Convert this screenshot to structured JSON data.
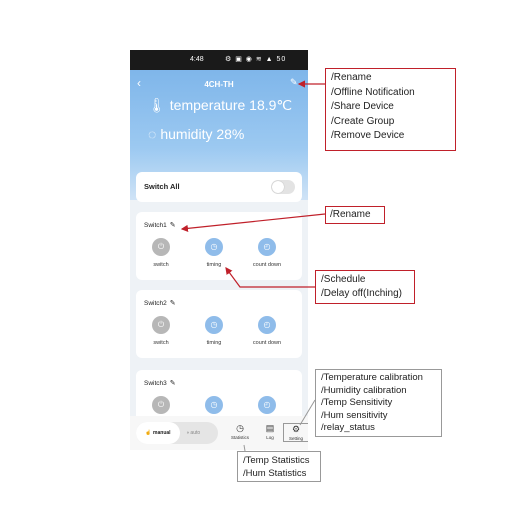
{
  "status_bar": {
    "time": "4:48",
    "icons": "⚙ ▣ ◉ ≋ ▲ 50"
  },
  "header": {
    "back_icon": "‹",
    "title": "4CH-TH",
    "edit_icon": "✎",
    "temperature_label": "temperature 18.9℃",
    "humidity_label": "humidity 28%"
  },
  "switch_all": {
    "label": "Switch All"
  },
  "switches": [
    {
      "name": "Switch1",
      "actions": [
        "switch",
        "timing",
        "count down"
      ]
    },
    {
      "name": "Switch2",
      "actions": [
        "switch",
        "timing",
        "count down"
      ]
    },
    {
      "name": "Switch3"
    }
  ],
  "bottom": {
    "manual_label": "manual",
    "auto_label": "auto",
    "tabs": [
      "Statistics",
      "Log",
      "Setting"
    ]
  },
  "annotations": {
    "device_menu": [
      "/Rename",
      "/Offline Notification",
      "/Share Device",
      "/Create Group",
      "/Remove Device"
    ],
    "switch_rename": "/Rename",
    "timing_menu": [
      "/Schedule",
      "/Delay off(Inching)"
    ],
    "setting_menu": [
      "/Temperature calibration",
      "/Humidity calibration",
      "/Temp Sensitivity",
      "/Hum sensitivity",
      "/relay_status"
    ],
    "statistics_menu": [
      "/Temp Statistics",
      "/Hum Statistics"
    ]
  },
  "colors": {
    "accent": "#8fbcea",
    "header_top": "#7fb6ea",
    "annotation_border": "#c0202a",
    "arrow": "#c0202a"
  }
}
